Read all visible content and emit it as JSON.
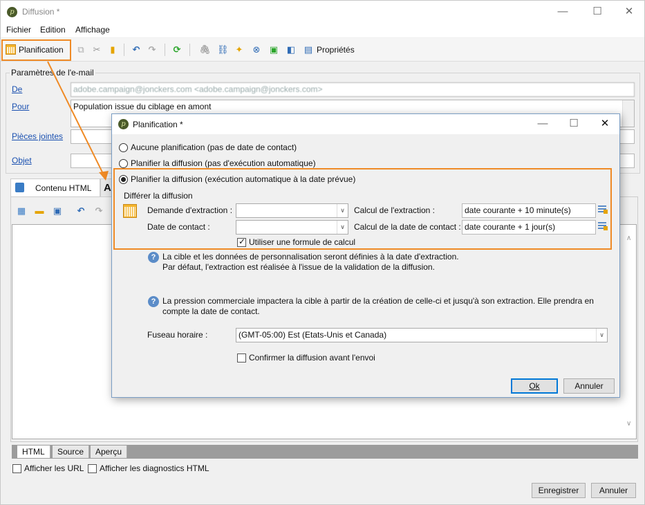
{
  "window": {
    "title": "Diffusion *",
    "minimize": "—",
    "maximize": "☐",
    "close": "✕"
  },
  "menu": [
    "Fichier",
    "Edition",
    "Affichage"
  ],
  "toolbar": {
    "planification_label": "Planification",
    "proprietes_label": "Propriétés"
  },
  "email_params": {
    "legend": "Paramètres de l'e-mail",
    "de_label": "De",
    "de_value": "adobe.campaign@jonckers.com <adobe.campaign@jonckers.com>",
    "pour_label": "Pour",
    "pour_value": "Population issue du ciblage en amont",
    "pieces_label": "Pièces jointes",
    "objet_label": "Objet"
  },
  "content_tabs": {
    "tab1": "Contenu HTML",
    "tab2": "A"
  },
  "bottom_tabs": [
    "HTML",
    "Source",
    "Aperçu"
  ],
  "checks": {
    "afficher_url": "Afficher les URL",
    "afficher_diag": "Afficher les diagnostics HTML"
  },
  "footer": {
    "save": "Enregistrer",
    "cancel": "Annuler"
  },
  "dialog": {
    "title": "Planification *",
    "opt_none": "Aucune planification (pas de date de contact)",
    "opt_plan": "Planifier la diffusion (pas d'exécution automatique)",
    "opt_plan_auto": "Planifier la diffusion (exécution automatique à la date prévue)",
    "differ_legend": "Différer la diffusion",
    "demande_label": "Demande d'extraction :",
    "demande_value": "",
    "date_contact_label": "Date de contact :",
    "date_contact_value": "",
    "calc_extraction_label": "Calcul de l'extraction :",
    "calc_extraction_value": "date courante + 10 minute(s)",
    "calc_contact_label": "Calcul de la date de contact :",
    "calc_contact_value": "date courante + 1 jour(s)",
    "use_formula": "Utiliser une formule de calcul",
    "info1_line1": "La cible et les données de personnalisation seront définies à la date d'extraction.",
    "info1_line2": "Par défaut, l'extraction est réalisée à l'issue de la validation de la diffusion.",
    "info2_line1": "La pression commerciale impactera la cible à partir de la création de celle-ci et jusqu'à son extraction. Elle prendra en",
    "info2_line2": "compte la date de contact.",
    "timezone_label": "Fuseau horaire :",
    "timezone_value": "(GMT-05:00) Est (Etats-Unis et Canada)",
    "confirm_label": "Confirmer la diffusion avant l'envoi",
    "ok": "Ok",
    "cancel": "Annuler"
  },
  "colors": {
    "highlight": "#ef8a25",
    "link": "#1a50b0",
    "calendar": "#f4b52d"
  }
}
